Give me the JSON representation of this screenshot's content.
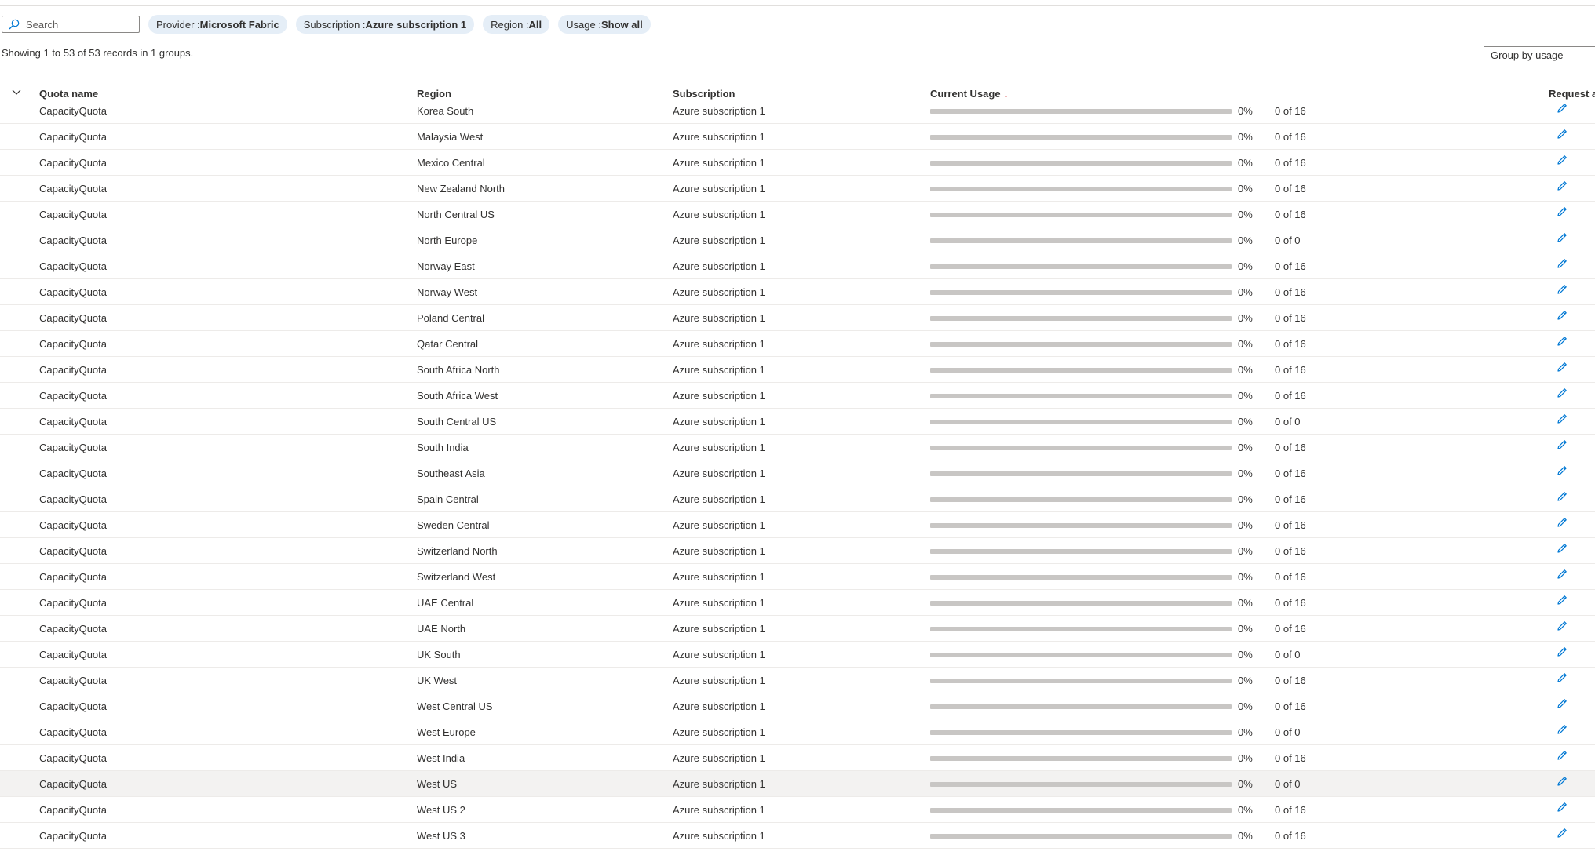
{
  "search": {
    "placeholder": "Search",
    "value": ""
  },
  "filters": [
    {
      "key": "Provider : ",
      "value": "Microsoft Fabric"
    },
    {
      "key": "Subscription : ",
      "value": "Azure subscription 1"
    },
    {
      "key": "Region : ",
      "value": "All"
    },
    {
      "key": "Usage : ",
      "value": "Show all"
    }
  ],
  "records_text": "Showing 1 to 53 of 53 records in 1 groups.",
  "group_by": "Group by usage",
  "columns": {
    "quota_name": "Quota name",
    "region": "Region",
    "subscription": "Subscription",
    "current_usage": "Current Usage",
    "sort_arrow": "↓",
    "request": "Request ac"
  },
  "colors": {
    "accent": "#0078d4",
    "pill_bg": "#e5eef7",
    "bar_track": "#c8c6c4",
    "selected_row": "#f3f2f1"
  },
  "selected_row_index": 26,
  "rows": [
    {
      "quota": "CapacityQuota",
      "region": "Korea South",
      "subscription": "Azure subscription 1",
      "percent": "0%",
      "usage": "0 of 16",
      "fraction": 0
    },
    {
      "quota": "CapacityQuota",
      "region": "Malaysia West",
      "subscription": "Azure subscription 1",
      "percent": "0%",
      "usage": "0 of 16",
      "fraction": 0
    },
    {
      "quota": "CapacityQuota",
      "region": "Mexico Central",
      "subscription": "Azure subscription 1",
      "percent": "0%",
      "usage": "0 of 16",
      "fraction": 0
    },
    {
      "quota": "CapacityQuota",
      "region": "New Zealand North",
      "subscription": "Azure subscription 1",
      "percent": "0%",
      "usage": "0 of 16",
      "fraction": 0
    },
    {
      "quota": "CapacityQuota",
      "region": "North Central US",
      "subscription": "Azure subscription 1",
      "percent": "0%",
      "usage": "0 of 16",
      "fraction": 0
    },
    {
      "quota": "CapacityQuota",
      "region": "North Europe",
      "subscription": "Azure subscription 1",
      "percent": "0%",
      "usage": "0 of 0",
      "fraction": 0
    },
    {
      "quota": "CapacityQuota",
      "region": "Norway East",
      "subscription": "Azure subscription 1",
      "percent": "0%",
      "usage": "0 of 16",
      "fraction": 0
    },
    {
      "quota": "CapacityQuota",
      "region": "Norway West",
      "subscription": "Azure subscription 1",
      "percent": "0%",
      "usage": "0 of 16",
      "fraction": 0
    },
    {
      "quota": "CapacityQuota",
      "region": "Poland Central",
      "subscription": "Azure subscription 1",
      "percent": "0%",
      "usage": "0 of 16",
      "fraction": 0
    },
    {
      "quota": "CapacityQuota",
      "region": "Qatar Central",
      "subscription": "Azure subscription 1",
      "percent": "0%",
      "usage": "0 of 16",
      "fraction": 0
    },
    {
      "quota": "CapacityQuota",
      "region": "South Africa North",
      "subscription": "Azure subscription 1",
      "percent": "0%",
      "usage": "0 of 16",
      "fraction": 0
    },
    {
      "quota": "CapacityQuota",
      "region": "South Africa West",
      "subscription": "Azure subscription 1",
      "percent": "0%",
      "usage": "0 of 16",
      "fraction": 0
    },
    {
      "quota": "CapacityQuota",
      "region": "South Central US",
      "subscription": "Azure subscription 1",
      "percent": "0%",
      "usage": "0 of 0",
      "fraction": 0
    },
    {
      "quota": "CapacityQuota",
      "region": "South India",
      "subscription": "Azure subscription 1",
      "percent": "0%",
      "usage": "0 of 16",
      "fraction": 0
    },
    {
      "quota": "CapacityQuota",
      "region": "Southeast Asia",
      "subscription": "Azure subscription 1",
      "percent": "0%",
      "usage": "0 of 16",
      "fraction": 0
    },
    {
      "quota": "CapacityQuota",
      "region": "Spain Central",
      "subscription": "Azure subscription 1",
      "percent": "0%",
      "usage": "0 of 16",
      "fraction": 0
    },
    {
      "quota": "CapacityQuota",
      "region": "Sweden Central",
      "subscription": "Azure subscription 1",
      "percent": "0%",
      "usage": "0 of 16",
      "fraction": 0
    },
    {
      "quota": "CapacityQuota",
      "region": "Switzerland North",
      "subscription": "Azure subscription 1",
      "percent": "0%",
      "usage": "0 of 16",
      "fraction": 0
    },
    {
      "quota": "CapacityQuota",
      "region": "Switzerland West",
      "subscription": "Azure subscription 1",
      "percent": "0%",
      "usage": "0 of 16",
      "fraction": 0
    },
    {
      "quota": "CapacityQuota",
      "region": "UAE Central",
      "subscription": "Azure subscription 1",
      "percent": "0%",
      "usage": "0 of 16",
      "fraction": 0
    },
    {
      "quota": "CapacityQuota",
      "region": "UAE North",
      "subscription": "Azure subscription 1",
      "percent": "0%",
      "usage": "0 of 16",
      "fraction": 0
    },
    {
      "quota": "CapacityQuota",
      "region": "UK South",
      "subscription": "Azure subscription 1",
      "percent": "0%",
      "usage": "0 of 0",
      "fraction": 0
    },
    {
      "quota": "CapacityQuota",
      "region": "UK West",
      "subscription": "Azure subscription 1",
      "percent": "0%",
      "usage": "0 of 16",
      "fraction": 0
    },
    {
      "quota": "CapacityQuota",
      "region": "West Central US",
      "subscription": "Azure subscription 1",
      "percent": "0%",
      "usage": "0 of 16",
      "fraction": 0
    },
    {
      "quota": "CapacityQuota",
      "region": "West Europe",
      "subscription": "Azure subscription 1",
      "percent": "0%",
      "usage": "0 of 0",
      "fraction": 0
    },
    {
      "quota": "CapacityQuota",
      "region": "West India",
      "subscription": "Azure subscription 1",
      "percent": "0%",
      "usage": "0 of 16",
      "fraction": 0
    },
    {
      "quota": "CapacityQuota",
      "region": "West US",
      "subscription": "Azure subscription 1",
      "percent": "0%",
      "usage": "0 of 0",
      "fraction": 0
    },
    {
      "quota": "CapacityQuota",
      "region": "West US 2",
      "subscription": "Azure subscription 1",
      "percent": "0%",
      "usage": "0 of 16",
      "fraction": 0
    },
    {
      "quota": "CapacityQuota",
      "region": "West US 3",
      "subscription": "Azure subscription 1",
      "percent": "0%",
      "usage": "0 of 16",
      "fraction": 0
    }
  ]
}
